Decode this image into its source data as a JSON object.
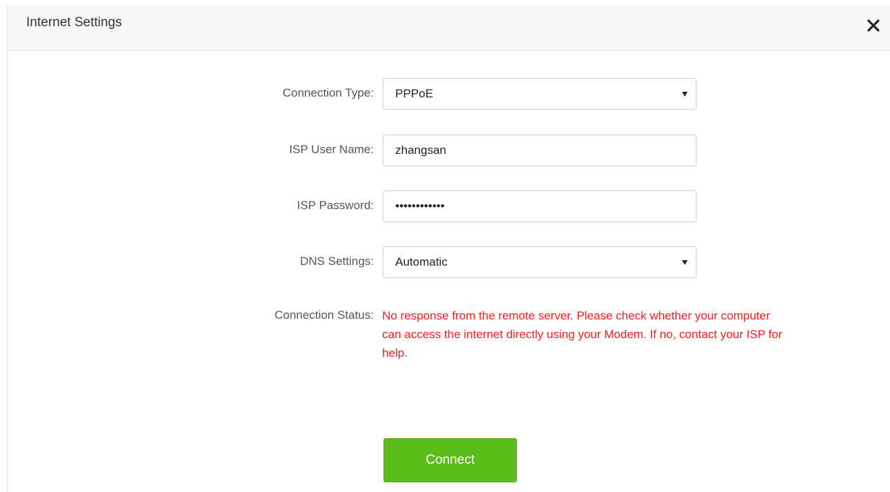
{
  "dialog": {
    "title": "Internet Settings",
    "close_icon": "close-icon"
  },
  "form": {
    "connection_type": {
      "label": "Connection Type:",
      "value": "PPPoE"
    },
    "isp_user_name": {
      "label": "ISP User Name:",
      "value": "zhangsan"
    },
    "isp_password": {
      "label": "ISP Password:",
      "value": "••••••••••••"
    },
    "dns_settings": {
      "label": "DNS Settings:",
      "value": "Automatic"
    },
    "connection_status": {
      "label": "Connection Status:",
      "message_lines": [
        "No response from the remote server. Please check whether your computer",
        "can access the internet directly using your Modem. If no, contact your ISP for",
        "help."
      ]
    }
  },
  "actions": {
    "connect_label": "Connect"
  },
  "colors": {
    "status_error": "#ff1a1a",
    "connect_button": "#5cbc1c"
  }
}
